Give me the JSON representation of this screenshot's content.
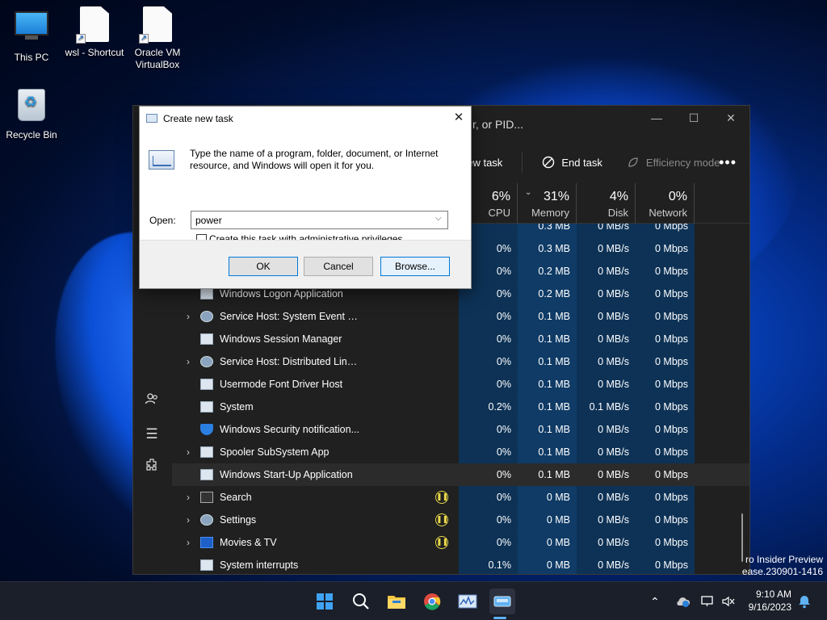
{
  "desktop": {
    "icons": [
      {
        "label": "This PC",
        "icon": "computer-icon"
      },
      {
        "label": "wsl - Shortcut",
        "icon": "shortcut-file-icon"
      },
      {
        "label": "Oracle VM VirtualBox",
        "icon": "shortcut-file-icon"
      },
      {
        "label": "Recycle Bin",
        "icon": "recycle-bin-icon"
      }
    ]
  },
  "task_manager": {
    "search_placeholder": "r, or PID...",
    "toolbar": {
      "run_new_task": "new task",
      "end_task": "End task",
      "efficiency_mode": "Efficiency mode",
      "more": "•••"
    },
    "window_buttons": {
      "minimize": "—",
      "maximize": "☐",
      "close": "✕"
    },
    "columns": [
      {
        "pct": "6%",
        "label": "CPU"
      },
      {
        "pct": "31%",
        "label": "Memory"
      },
      {
        "pct": "4%",
        "label": "Disk"
      },
      {
        "pct": "0%",
        "label": "Network"
      }
    ],
    "rows": [
      {
        "name": "",
        "expand": false,
        "icon": "app-icon",
        "status": false,
        "cpu": "",
        "mem": "0.3 MB",
        "disk": "0 MB/s",
        "net": "0 Mbps"
      },
      {
        "name": "",
        "expand": false,
        "icon": "app-icon",
        "status": false,
        "cpu": "0%",
        "mem": "0.3 MB",
        "disk": "0 MB/s",
        "net": "0 Mbps"
      },
      {
        "name": "",
        "expand": false,
        "icon": "app-icon",
        "status": false,
        "cpu": "0%",
        "mem": "0.2 MB",
        "disk": "0 MB/s",
        "net": "0 Mbps"
      },
      {
        "name": "Windows Logon Application",
        "expand": false,
        "icon": "app-icon",
        "status": false,
        "cpu": "0%",
        "mem": "0.2 MB",
        "disk": "0 MB/s",
        "net": "0 Mbps"
      },
      {
        "name": "Service Host: System Event No...",
        "expand": true,
        "icon": "gear-icon",
        "status": false,
        "cpu": "0%",
        "mem": "0.1 MB",
        "disk": "0 MB/s",
        "net": "0 Mbps"
      },
      {
        "name": "Windows Session Manager",
        "expand": false,
        "icon": "app-icon",
        "status": false,
        "cpu": "0%",
        "mem": "0.1 MB",
        "disk": "0 MB/s",
        "net": "0 Mbps"
      },
      {
        "name": "Service Host: Distributed Link ...",
        "expand": true,
        "icon": "gear-icon",
        "status": false,
        "cpu": "0%",
        "mem": "0.1 MB",
        "disk": "0 MB/s",
        "net": "0 Mbps"
      },
      {
        "name": "Usermode Font Driver Host",
        "expand": false,
        "icon": "app-icon",
        "status": false,
        "cpu": "0%",
        "mem": "0.1 MB",
        "disk": "0 MB/s",
        "net": "0 Mbps"
      },
      {
        "name": "System",
        "expand": false,
        "icon": "app-icon",
        "status": false,
        "cpu": "0.2%",
        "mem": "0.1 MB",
        "disk": "0.1 MB/s",
        "net": "0 Mbps"
      },
      {
        "name": "Windows Security notification...",
        "expand": false,
        "icon": "shield-icon",
        "status": false,
        "cpu": "0%",
        "mem": "0.1 MB",
        "disk": "0 MB/s",
        "net": "0 Mbps"
      },
      {
        "name": "Spooler SubSystem App",
        "expand": true,
        "icon": "printer-icon",
        "status": false,
        "cpu": "0%",
        "mem": "0.1 MB",
        "disk": "0 MB/s",
        "net": "0 Mbps"
      },
      {
        "name": "Windows Start-Up Application",
        "expand": false,
        "icon": "app-icon",
        "status": false,
        "cpu": "0%",
        "mem": "0.1 MB",
        "disk": "0 MB/s",
        "net": "0 Mbps",
        "selected": true
      },
      {
        "name": "Search",
        "expand": true,
        "icon": "search-app-icon",
        "status": true,
        "cpu": "0%",
        "mem": "0 MB",
        "disk": "0 MB/s",
        "net": "0 Mbps"
      },
      {
        "name": "Settings",
        "expand": true,
        "icon": "gear-icon",
        "status": true,
        "cpu": "0%",
        "mem": "0 MB",
        "disk": "0 MB/s",
        "net": "0 Mbps"
      },
      {
        "name": "Movies & TV",
        "expand": true,
        "icon": "movies-icon",
        "status": true,
        "cpu": "0%",
        "mem": "0 MB",
        "disk": "0 MB/s",
        "net": "0 Mbps"
      },
      {
        "name": "System interrupts",
        "expand": false,
        "icon": "app-icon",
        "status": false,
        "cpu": "0.1%",
        "mem": "0 MB",
        "disk": "0 MB/s",
        "net": "0 Mbps"
      }
    ]
  },
  "dialog": {
    "title": "Create new task",
    "close": "✕",
    "description": "Type the name of a program, folder, document, or Internet resource, and Windows will open it for you.",
    "open_label": "Open:",
    "open_value": "power",
    "admin_checkbox_label": "Create this task with administrative privileges.",
    "admin_checked": false,
    "ok": "OK",
    "cancel": "Cancel",
    "browse": "Browse..."
  },
  "watermark": {
    "line1": "ro Insider Preview",
    "line2": "ease.230901-1416"
  },
  "taskbar": {
    "time": "9:10 AM",
    "date": "9/16/2023"
  },
  "colors": {
    "accent": "#0078d7",
    "taskbar_bg": "#1b1f2a",
    "tm_bg": "#202020",
    "status_yellow": "#e8d84a"
  }
}
